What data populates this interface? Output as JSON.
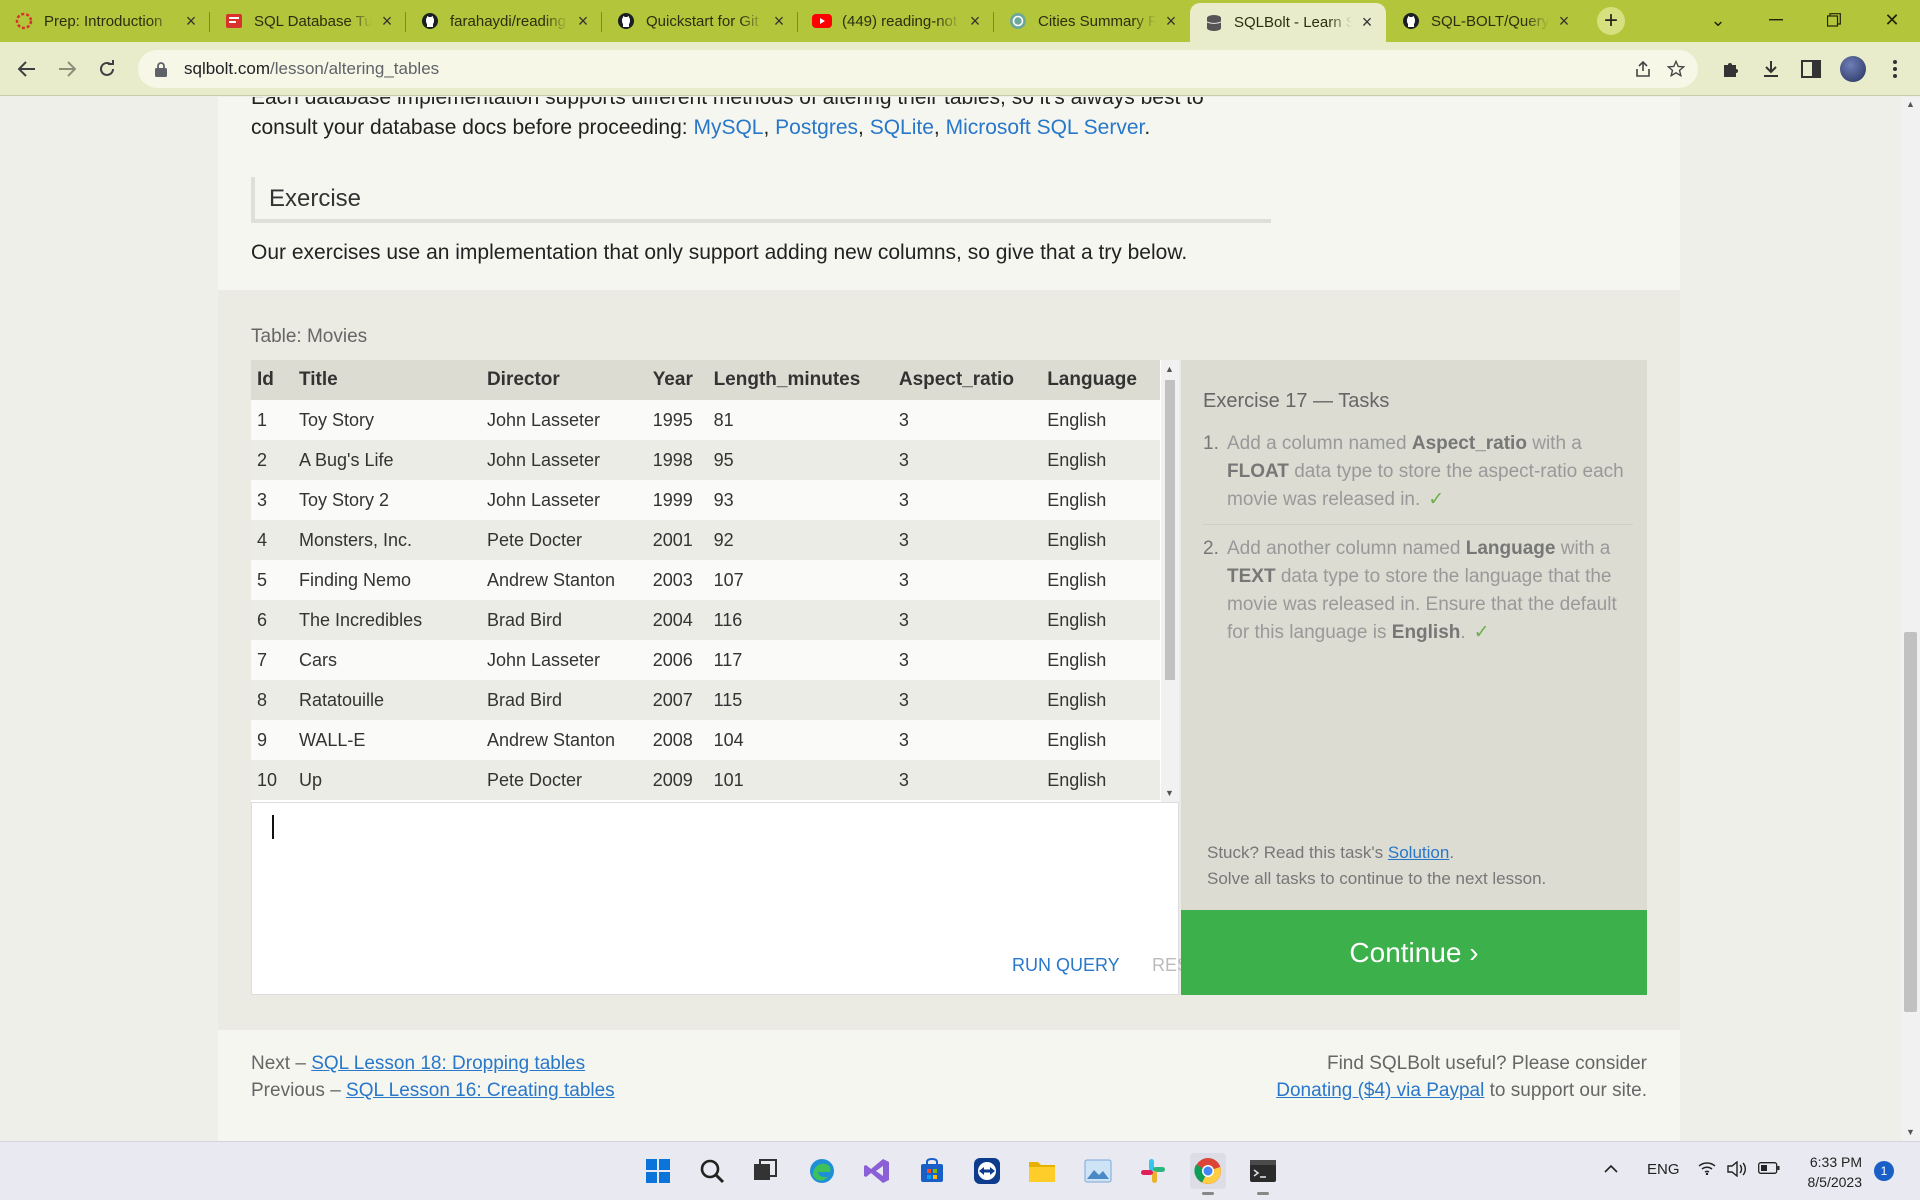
{
  "browser": {
    "tabs": [
      {
        "title": "Prep: Introduction",
        "icon": "prep-icon",
        "active": false
      },
      {
        "title": "SQL Database Tut",
        "icon": "sql-tutorial-icon",
        "active": false
      },
      {
        "title": "farahaydi/reading",
        "icon": "github-icon",
        "active": false
      },
      {
        "title": "Quickstart for Git",
        "icon": "github-icon",
        "active": false
      },
      {
        "title": "(449) reading-not",
        "icon": "youtube-icon",
        "active": false
      },
      {
        "title": "Cities Summary R",
        "icon": "chatgpt-icon",
        "active": false
      },
      {
        "title": "SQLBolt - Learn S",
        "icon": "sqlbolt-icon",
        "active": true
      },
      {
        "title": "SQL-BOLT/Query",
        "icon": "github-icon",
        "active": false
      }
    ],
    "url_host": "sqlbolt.com",
    "url_path": "/lesson/altering_tables"
  },
  "page": {
    "intro_line1": "Each database implementation supports different methods of altering their tables, so it's always best to",
    "intro_line2_prefix": "consult your database docs before proceeding: ",
    "doc_links": [
      "MySQL",
      "Postgres",
      "SQLite",
      "Microsoft SQL Server"
    ],
    "exercise_heading": "Exercise",
    "exercise_text": "Our exercises use an implementation that only support adding new columns, so give that a try below."
  },
  "table": {
    "label": "Table: Movies",
    "columns": [
      "Id",
      "Title",
      "Director",
      "Year",
      "Length_minutes",
      "Aspect_ratio",
      "Language"
    ],
    "rows": [
      [
        "1",
        "Toy Story",
        "John Lasseter",
        "1995",
        "81",
        "3",
        "English"
      ],
      [
        "2",
        "A Bug's Life",
        "John Lasseter",
        "1998",
        "95",
        "3",
        "English"
      ],
      [
        "3",
        "Toy Story 2",
        "John Lasseter",
        "1999",
        "93",
        "3",
        "English"
      ],
      [
        "4",
        "Monsters, Inc.",
        "Pete Docter",
        "2001",
        "92",
        "3",
        "English"
      ],
      [
        "5",
        "Finding Nemo",
        "Andrew Stanton",
        "2003",
        "107",
        "3",
        "English"
      ],
      [
        "6",
        "The Incredibles",
        "Brad Bird",
        "2004",
        "116",
        "3",
        "English"
      ],
      [
        "7",
        "Cars",
        "John Lasseter",
        "2006",
        "117",
        "3",
        "English"
      ],
      [
        "8",
        "Ratatouille",
        "Brad Bird",
        "2007",
        "115",
        "3",
        "English"
      ],
      [
        "9",
        "WALL-E",
        "Andrew Stanton",
        "2008",
        "104",
        "3",
        "English"
      ],
      [
        "10",
        "Up",
        "Pete Docter",
        "2009",
        "101",
        "3",
        "English"
      ]
    ]
  },
  "editor": {
    "run_label": "RUN QUERY",
    "reset_label": "RESET"
  },
  "tasks": {
    "title": "Exercise 17 — Tasks",
    "items": [
      {
        "num": "1.",
        "parts": [
          "Add a column named ",
          "Aspect_ratio",
          " with a ",
          "FLOAT",
          " data type to store the aspect-ratio each movie was released in."
        ],
        "done": true
      },
      {
        "num": "2.",
        "parts": [
          "Add another column named ",
          "Language",
          " with a ",
          "TEXT",
          " data type to store the language that the movie was released in. Ensure that the default for this language is ",
          "English",
          "."
        ],
        "done": true
      }
    ],
    "check_mark": "✓",
    "stuck_prefix": "Stuck? Read this task's ",
    "solution_link": "Solution",
    "stuck_suffix": ".",
    "solve_all": "Solve all tasks to continue to the next lesson.",
    "continue_label": "Continue ›"
  },
  "footer": {
    "next_prefix": "Next – ",
    "next_link": "SQL Lesson 18: Dropping tables",
    "prev_prefix": "Previous – ",
    "prev_link": "SQL Lesson 16: Creating tables",
    "support_line1": "Find SQLBolt useful? Please consider",
    "donate_link": "Donating ($4) via Paypal",
    "support_suffix": " to support our site."
  },
  "taskbar": {
    "apps": [
      "windows-start-icon",
      "search-icon",
      "task-view-icon",
      "edge-icon",
      "visual-studio-icon",
      "store-icon",
      "teamviewer-icon",
      "file-explorer-icon",
      "photos-icon",
      "slack-icon",
      "chrome-icon",
      "terminal-icon"
    ],
    "language": "ENG",
    "time": "6:33 PM",
    "date": "8/5/2023",
    "notifications": "1"
  },
  "colors": {
    "tab_bar": "#b3c53b",
    "link": "#2877c9",
    "continue": "#3cb04a"
  }
}
